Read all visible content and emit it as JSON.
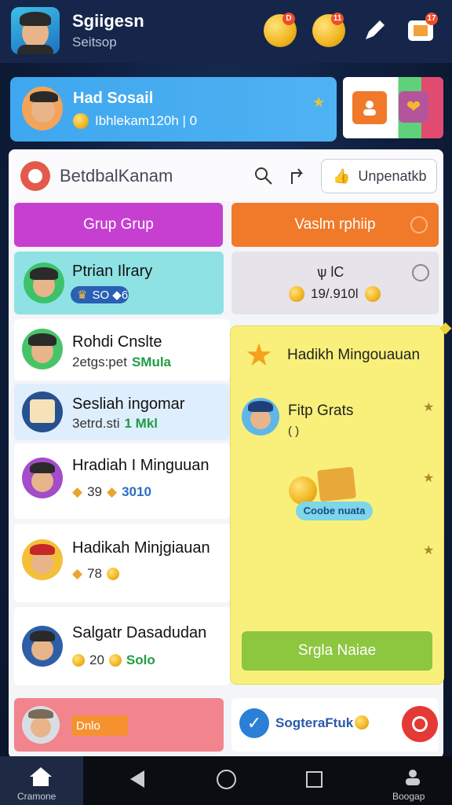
{
  "app": {
    "title": "Sgiigesn",
    "subtitle": "Seitsop"
  },
  "top_icons": [
    {
      "name": "coin-icon",
      "badge": ""
    },
    {
      "name": "coin-icon",
      "badge": "11"
    },
    {
      "name": "edit-icon"
    },
    {
      "name": "box-icon",
      "badge": "17"
    }
  ],
  "profile": {
    "name": "Had Sosail",
    "coins": "Ibhlekam120h | 0"
  },
  "panel": {
    "title": "BetdbalKanam",
    "action_label": "Unpenatkb",
    "tab_left": "Grup Grup",
    "tab_right": "Vaslm rphiip"
  },
  "rows": [
    {
      "title": "Ptrian Ilrary",
      "meta": "SO ◆6"
    },
    {
      "title": "Rohdi Cnslte",
      "meta_a": "2etgs:pet",
      "meta_b": "SMula"
    },
    {
      "title": "Sesliah ingomar",
      "meta_a": "3etrd.sti",
      "meta_b": "1 Mkl"
    },
    {
      "title": "Hradiah I Minguuan",
      "meta_a": "39",
      "meta_b": "3010"
    },
    {
      "title": "Hadikah Minjgiauan",
      "meta_a": "78"
    },
    {
      "title": "Salgatr Dasadudan",
      "meta_a": "20",
      "meta_b": "Solo"
    }
  ],
  "right_card": {
    "label": "ѱ lC",
    "value": "19/.910l"
  },
  "popup": {
    "title": "Hadikh Mingouauan",
    "item_title": "Fitp Grats",
    "item_sub": "( )",
    "chest_label": "Coobe nuata",
    "button": "Srgla Naiae"
  },
  "bottom": {
    "left_pill": "Dnlo",
    "right_text": "SogteraFtuk"
  },
  "nav": {
    "home_label": "Cramone",
    "profile_label": "Boogap"
  }
}
